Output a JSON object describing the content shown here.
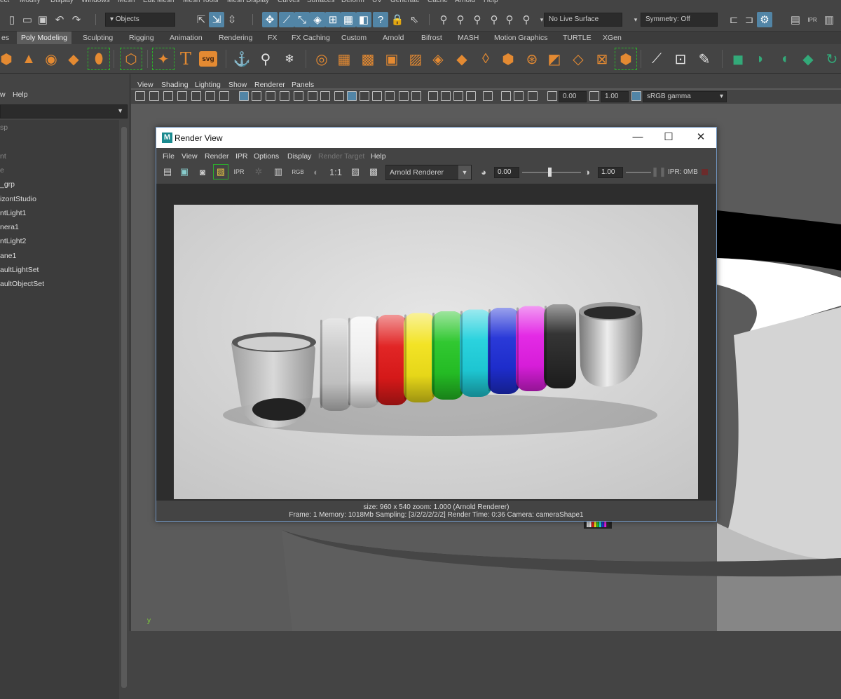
{
  "main_menu": [
    "ect",
    "Modify",
    "Display",
    "Windows",
    "Mesh",
    "Edit Mesh",
    "Mesh Tools",
    "Mesh Display",
    "Curves",
    "Surfaces",
    "Deform",
    "UV",
    "Generate",
    "Cache",
    "Arnold",
    "Help"
  ],
  "status_line": {
    "selection_mode": "Objects",
    "live_surface": "No Live Surface",
    "symmetry": "Symmetry: Off"
  },
  "shelf_tabs": [
    "es",
    "Poly Modeling",
    "Sculpting",
    "Rigging",
    "Animation",
    "Rendering",
    "FX",
    "FX Caching",
    "Custom",
    "Arnold",
    "Bifrost",
    "MASH",
    "Motion Graphics",
    "TURTLE",
    "XGen"
  ],
  "active_shelf_tab": "Poly Modeling",
  "shelf_text_icons": {
    "text": "T",
    "svg": "svg"
  },
  "outliner": {
    "menu": [
      "w",
      "Help"
    ],
    "items": [
      {
        "label": "sp",
        "dim": true
      },
      {
        "label": "",
        "dim": true
      },
      {
        "label": "nt",
        "dim": true
      },
      {
        "label": "e",
        "dim": true
      },
      {
        "label": "_grp",
        "dim": false
      },
      {
        "label": "izontStudio",
        "dim": false
      },
      {
        "label": "ntLight1",
        "dim": false
      },
      {
        "label": "nera1",
        "dim": false
      },
      {
        "label": "ntLight2",
        "dim": false
      },
      {
        "label": "ane1",
        "dim": false
      },
      {
        "label": "aultLightSet",
        "dim": false
      },
      {
        "label": "aultObjectSet",
        "dim": false
      }
    ]
  },
  "viewport": {
    "menu": [
      "View",
      "Shading",
      "Lighting",
      "Show",
      "Renderer",
      "Panels"
    ],
    "exposure": "0.00",
    "gamma": "1.00",
    "color_space": "sRGB gamma",
    "axis_label": "y"
  },
  "render_view": {
    "title": "Render View",
    "menu": [
      {
        "label": "File",
        "disabled": false
      },
      {
        "label": "View",
        "disabled": false
      },
      {
        "label": "Render",
        "disabled": false
      },
      {
        "label": "IPR",
        "disabled": false
      },
      {
        "label": "Options",
        "disabled": false
      },
      {
        "label": "Display",
        "disabled": false
      },
      {
        "label": "Render Target",
        "disabled": true
      },
      {
        "label": "Help",
        "disabled": false
      }
    ],
    "toolbar": {
      "rgb_label": "RGB",
      "one_to_one": "1:1",
      "renderer": "Arnold Renderer",
      "exposure": "0.00",
      "gamma": "1.00",
      "ipr_memory": "IPR: 0MB"
    },
    "status_line1": "size: 960 x 540  zoom: 1.000     (Arnold Renderer)",
    "status_line2": "Frame: 1     Memory: 1018Mb     Sampling: [3/2/2/2/2/2]     Render Time: 0:36     Camera: cameraShape1",
    "ring_colors": [
      "#c9c9c9",
      "#f0f0f0",
      "#e01a1a",
      "#f2e21a",
      "#26c526",
      "#1fd0dc",
      "#1f2fd6",
      "#e21fe4",
      "#2a2a2a"
    ],
    "background_color": "#d8d8d8"
  },
  "colors": {
    "accent": "#5285a6",
    "shelf_orange": "#e48a32",
    "shelf_green": "#33a979"
  }
}
